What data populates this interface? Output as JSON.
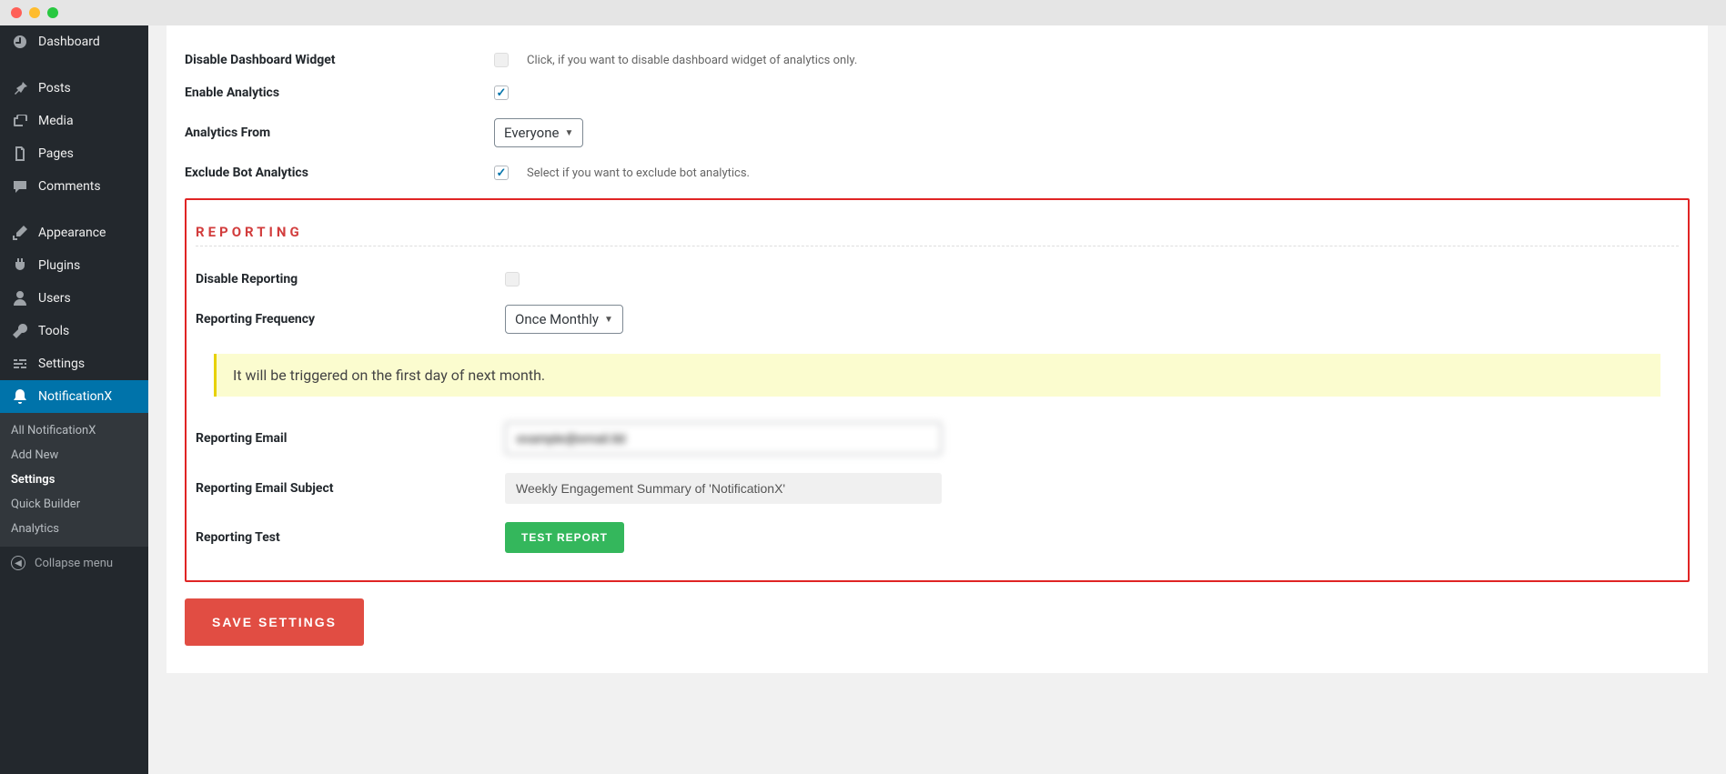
{
  "sidebar": {
    "items": [
      {
        "label": "Dashboard",
        "icon": "dashboard"
      },
      {
        "label": "Posts",
        "icon": "pin"
      },
      {
        "label": "Media",
        "icon": "media"
      },
      {
        "label": "Pages",
        "icon": "page"
      },
      {
        "label": "Comments",
        "icon": "comment"
      },
      {
        "label": "Appearance",
        "icon": "brush"
      },
      {
        "label": "Plugins",
        "icon": "plug"
      },
      {
        "label": "Users",
        "icon": "user"
      },
      {
        "label": "Tools",
        "icon": "wrench"
      },
      {
        "label": "Settings",
        "icon": "sliders"
      },
      {
        "label": "NotificationX",
        "icon": "bell",
        "active": true
      }
    ],
    "submenu": [
      {
        "label": "All NotificationX"
      },
      {
        "label": "Add New"
      },
      {
        "label": "Settings",
        "current": true
      },
      {
        "label": "Quick Builder"
      },
      {
        "label": "Analytics"
      }
    ],
    "collapse_label": "Collapse menu"
  },
  "analytics": {
    "disable_widget_label": "Disable Dashboard Widget",
    "disable_widget_help": "Click, if you want to disable dashboard widget of analytics only.",
    "enable_label": "Enable Analytics",
    "from_label": "Analytics From",
    "from_value": "Everyone",
    "exclude_bot_label": "Exclude Bot Analytics",
    "exclude_bot_help": "Select if you want to exclude bot analytics."
  },
  "reporting": {
    "heading": "REPORTING",
    "disable_label": "Disable Reporting",
    "frequency_label": "Reporting Frequency",
    "frequency_value": "Once Monthly",
    "notice": "It will be triggered on the first day of next month.",
    "email_label": "Reporting Email",
    "email_value": "example@email.tld",
    "subject_label": "Reporting Email Subject",
    "subject_value": "Weekly Engagement Summary of 'NotificationX'",
    "test_label": "Reporting Test",
    "test_button": "TEST REPORT"
  },
  "save_button": "SAVE SETTINGS"
}
